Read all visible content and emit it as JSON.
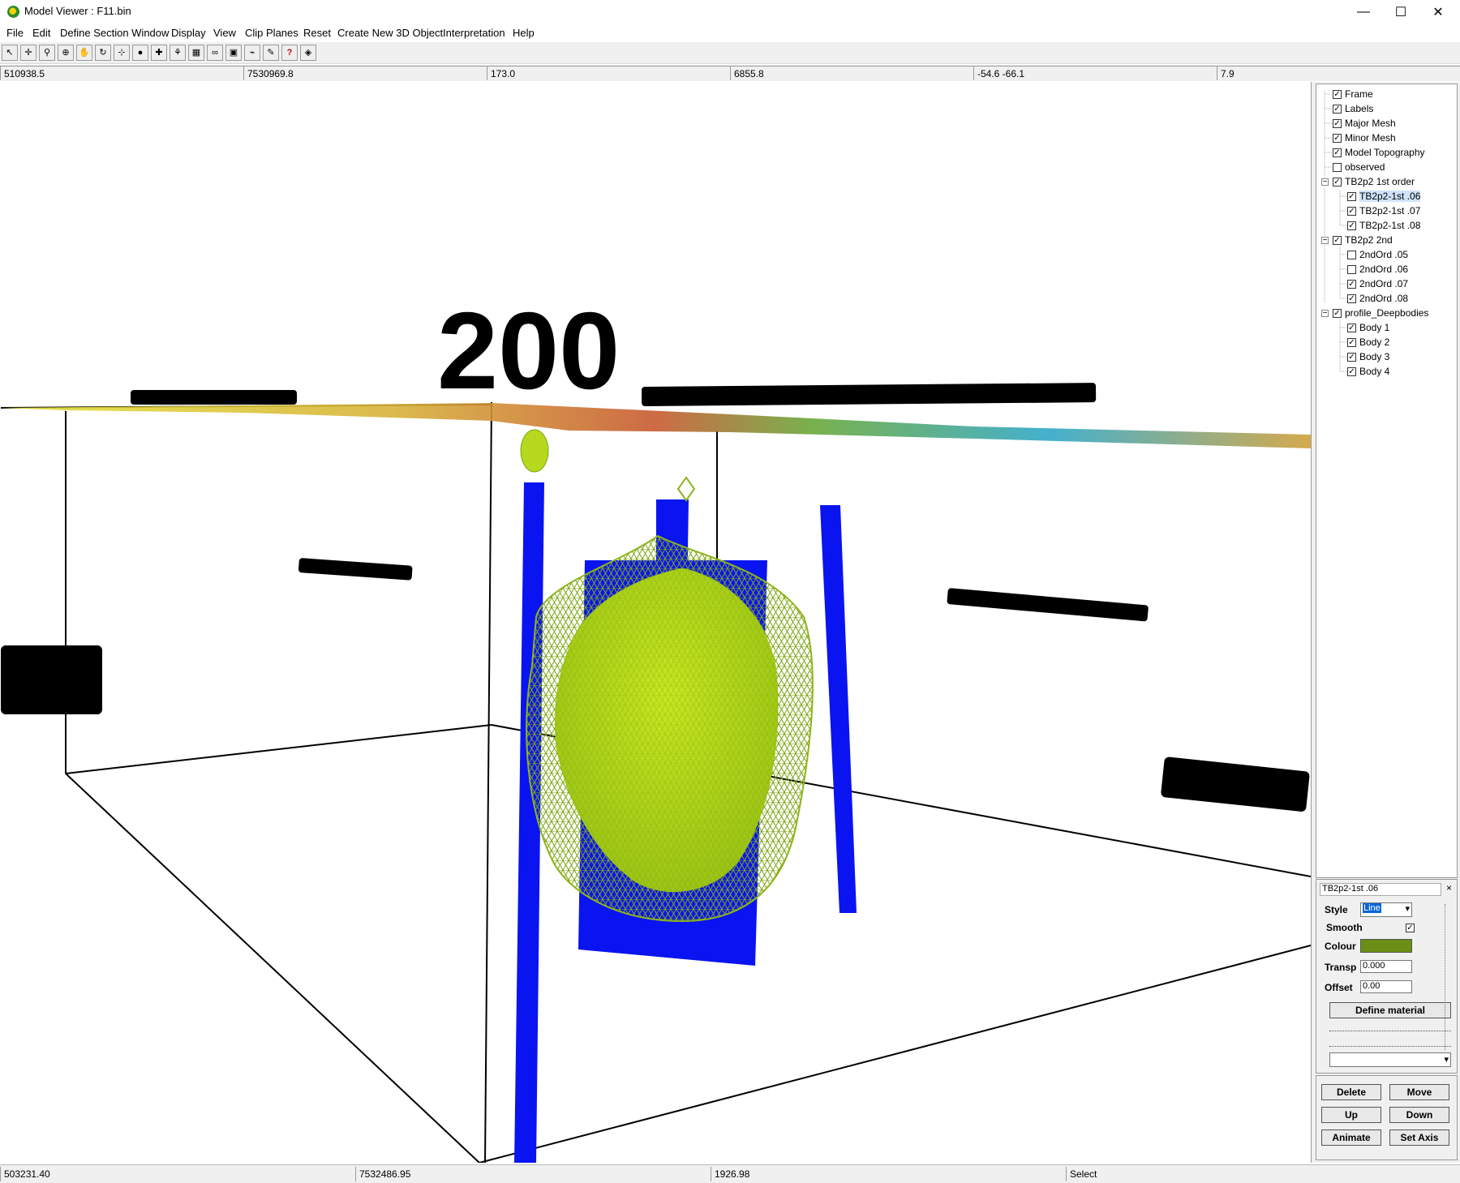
{
  "window": {
    "title": "Model Viewer : F11.bin",
    "minimize_glyph": "—",
    "maximize_glyph": "☐",
    "close_glyph": "✕"
  },
  "menu": [
    "File",
    "Edit",
    "Define Section Window",
    "Display",
    "View",
    "Clip Planes",
    "Reset",
    "Create New 3D Object",
    "Interpretation",
    "Help"
  ],
  "toolbar": {
    "icons": [
      "pointer-icon",
      "crosshair-move-icon",
      "zoom-icon",
      "zoom-in-icon",
      "pan-hand-icon",
      "rotate-icon",
      "axis-icon",
      "sphere-icon",
      "pin-axis-icon",
      "compass-icon",
      "grid-plane-icon",
      "binoculars-icon",
      "camera-icon",
      "drive-icon",
      "pencil-icon",
      "help-icon",
      "cube-icon"
    ],
    "glyphs": [
      "↖",
      "✛",
      "⚲",
      "⊕",
      "✋",
      "↻",
      "⊹",
      "●",
      "✚",
      "⚘",
      "▦",
      "∞",
      "▣",
      "⌁",
      "✎",
      "?",
      "◈"
    ]
  },
  "coords": [
    "510938.5",
    "7530969.8",
    "173.0",
    "6855.8",
    "-54.6  -66.1",
    "7.9"
  ],
  "viewport": {
    "label_200": "200",
    "colors": {
      "blue_body": "#0a14f0",
      "mesh_green": "#8db51a",
      "solid_green": "#b8dc1c",
      "frame": "#000000"
    }
  },
  "tree": {
    "items": [
      {
        "label": "Frame",
        "checked": true
      },
      {
        "label": "Labels",
        "checked": true
      },
      {
        "label": "Major Mesh",
        "checked": true
      },
      {
        "label": "Minor Mesh",
        "checked": true
      },
      {
        "label": "Model Topography",
        "checked": true
      },
      {
        "label": "observed",
        "checked": false
      },
      {
        "label": "TB2p2 1st order",
        "checked": true
      },
      {
        "label": "TB2p2-1st  .06",
        "checked": true
      },
      {
        "label": "TB2p2-1st  .07",
        "checked": true
      },
      {
        "label": "TB2p2-1st  .08",
        "checked": true
      },
      {
        "label": "TB2p2 2nd",
        "checked": true
      },
      {
        "label": "2ndOrd  .05",
        "checked": false
      },
      {
        "label": "2ndOrd  .06",
        "checked": false
      },
      {
        "label": "2ndOrd  .07",
        "checked": true
      },
      {
        "label": "2ndOrd  .08",
        "checked": true
      },
      {
        "label": "profile_Deepbodies",
        "checked": true
      },
      {
        "label": "Body 1",
        "checked": true
      },
      {
        "label": "Body 2",
        "checked": true
      },
      {
        "label": "Body 3",
        "checked": true
      },
      {
        "label": "Body 4",
        "checked": true
      }
    ]
  },
  "props": {
    "object_name": "TB2p2-1st  .06",
    "style_label": "Style",
    "style_value": "Line",
    "smooth_label": "Smooth",
    "smooth_checked": true,
    "colour_label": "Colour",
    "colour_value": "#6b8e14",
    "transp_label": "Transp",
    "transp_value": "0.000",
    "offset_label": "Offset",
    "offset_value": "0.00",
    "define_material": "Define material",
    "close_glyph": "×",
    "dropdown_glyph": "▾"
  },
  "buttons": {
    "delete": "Delete",
    "move": "Move",
    "up": "Up",
    "down": "Down",
    "animate": "Animate",
    "set_axis": "Set Axis"
  },
  "status": [
    "503231.40",
    "7532486.95",
    "1926.98",
    "Select"
  ]
}
